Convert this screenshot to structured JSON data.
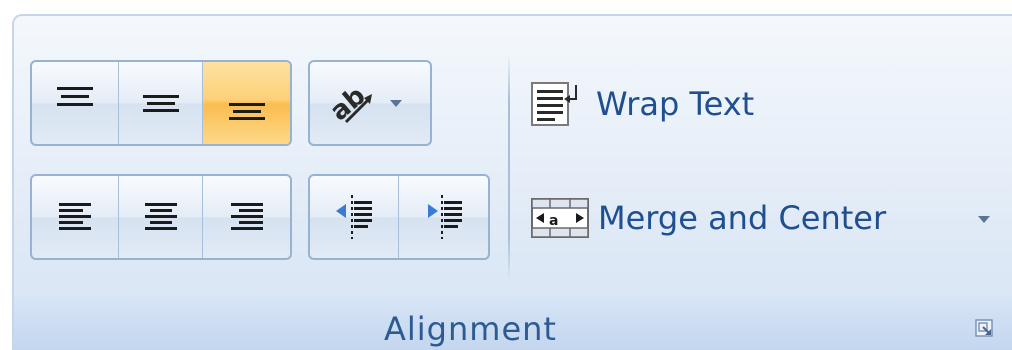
{
  "group": {
    "label": "Alignment"
  },
  "buttons": {
    "top_align": "Top Align",
    "middle_align": "Middle Align",
    "bottom_align": "Bottom Align",
    "orientation": "Orientation",
    "align_left": "Align Text Left",
    "center": "Center",
    "align_right": "Align Text Right",
    "decrease_indent": "Decrease Indent",
    "increase_indent": "Increase Indent",
    "wrap_text": "Wrap Text",
    "merge_and_center": "Merge and Center"
  },
  "state": {
    "active_button": "bottom_align"
  },
  "colors": {
    "label_blue": "#1f4f8f",
    "group_label": "#2e5a93",
    "active_orange": "#fbbd4f",
    "border_blue": "#98b2d2"
  }
}
